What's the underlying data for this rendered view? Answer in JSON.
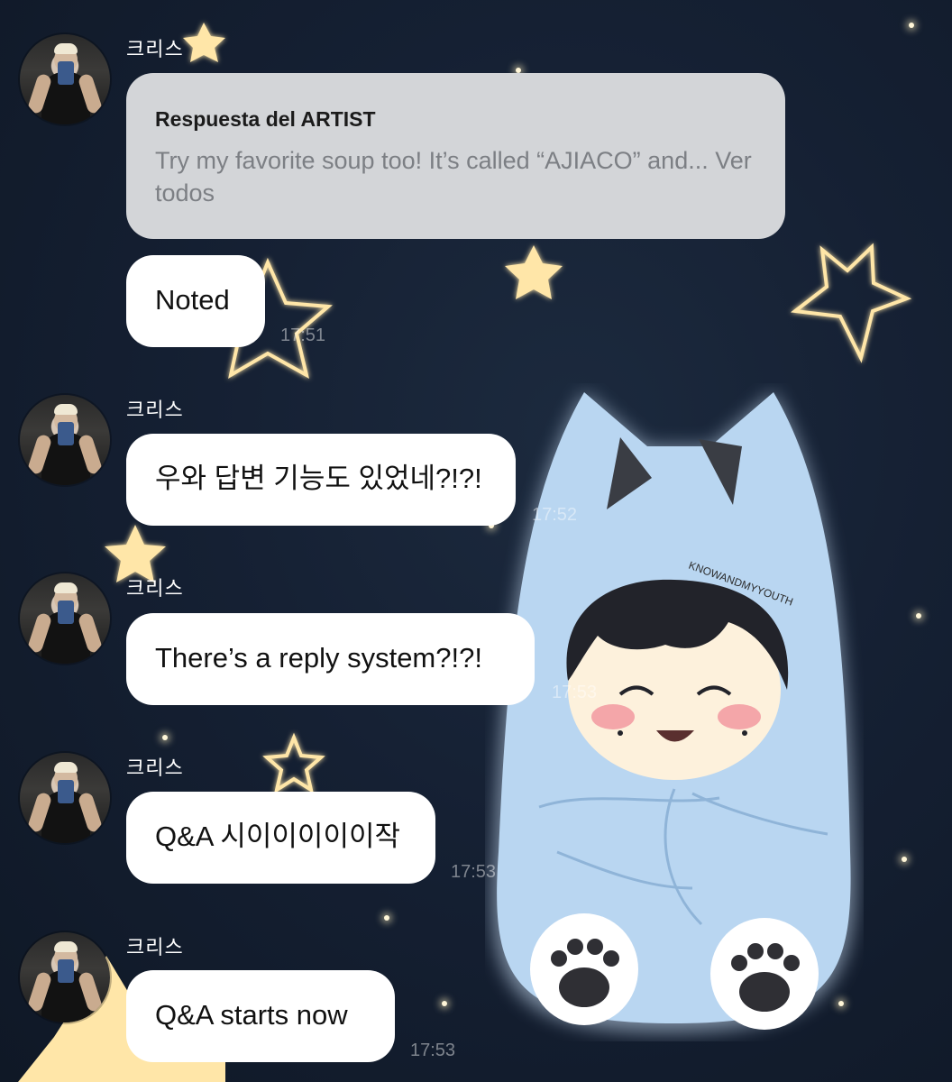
{
  "chat": {
    "reply_card": {
      "title": "Respuesta del ARTIST",
      "text": "Try my favorite soup too! It’s called “AJIACO” and...",
      "more": "Ver todos"
    },
    "messages": [
      {
        "sender": "크리스",
        "text": "Noted",
        "time": "17:51"
      },
      {
        "sender": "크리스",
        "text": "우와 답변 기능도 있었네?!?!",
        "time": "17:52"
      },
      {
        "sender": "크리스",
        "text": "There’s a reply system?!?!",
        "time": "17:53"
      },
      {
        "sender": "크리스",
        "text": "Q&A 시이이이이이작",
        "time": "17:53"
      },
      {
        "sender": "크리스",
        "text": "Q&A starts now",
        "time": "17:53"
      }
    ],
    "first_sender": "크리스",
    "sticker_text": "KNOWANDMYYOUTH"
  },
  "colors": {
    "background": "#152033",
    "bubble": "#ffffff",
    "reply_card": "#d3d5d8",
    "star": "#ffe6a8",
    "sticker_hood": "#b9d6f1"
  }
}
